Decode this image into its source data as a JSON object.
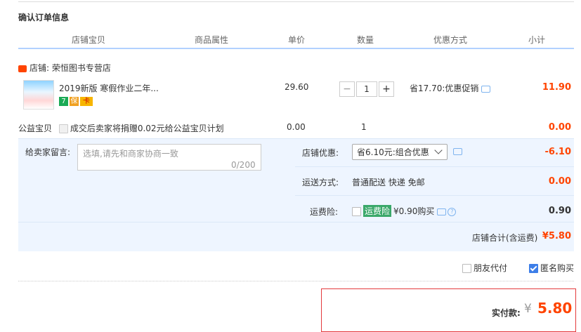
{
  "section_title": "确认订单信息",
  "columns": [
    "店铺宝贝",
    "商品属性",
    "单价",
    "数量",
    "优惠方式",
    "小计"
  ],
  "shop": {
    "label": "店铺: 荣恒图书专营店"
  },
  "item": {
    "name": "2019新版 寒假作业二年...",
    "badges": [
      "7",
      "保",
      "卡"
    ],
    "price": "29.60",
    "quantity": "1",
    "promo": "省17.70:优惠促销",
    "subtotal": "11.90"
  },
  "charity": {
    "label": "公益宝贝",
    "text": "成交后卖家将捐赠0.02元给公益宝贝计划",
    "price": "0.00",
    "quantity": "1",
    "subtotal": "0.00"
  },
  "message": {
    "label": "给卖家留言:",
    "placeholder": "选填,请先和商家协商一致",
    "count": "0/200"
  },
  "shop_discount": {
    "label": "店铺优惠:",
    "selected": "省6.10元:组合优惠",
    "value": "-6.10"
  },
  "shipping": {
    "label": "运送方式:",
    "text": "普通配送 快递 免邮",
    "value": "0.00"
  },
  "insurance": {
    "label": "运费险:",
    "tag": "运费险",
    "text": "¥0.90购买",
    "value": "0.90"
  },
  "shop_total": {
    "label": "店铺合计(含运费)",
    "value": "¥5.80"
  },
  "options": {
    "friend_pay": "朋友代付",
    "anonymous": "匿名购买"
  },
  "payment": {
    "label": "实付款:",
    "currency": "¥",
    "amount": "5.80"
  },
  "colors": {
    "accent_red": "#ff4400",
    "header_line": "#b2d1ff",
    "panel_bg": "#eef5ff",
    "checkbox_blue": "#3d7ee8"
  }
}
